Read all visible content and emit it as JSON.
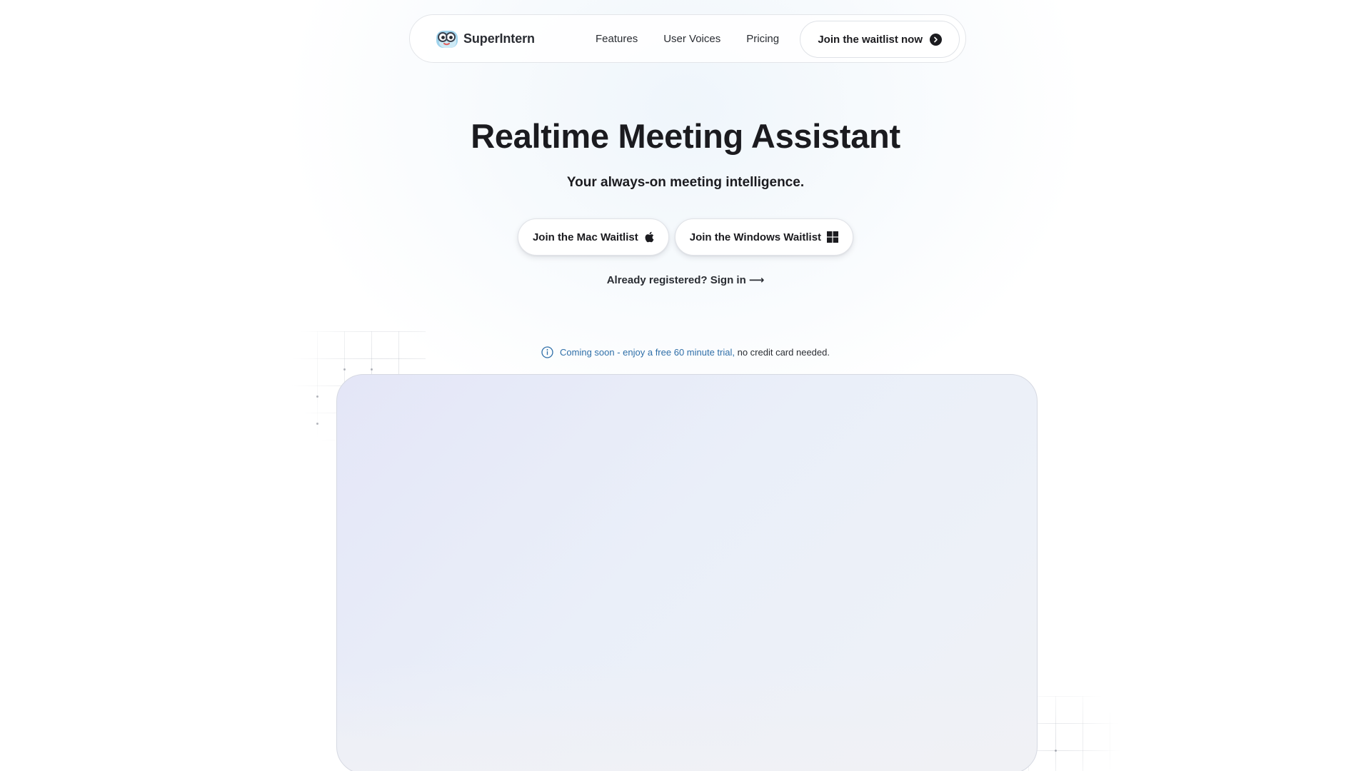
{
  "nav": {
    "brand": "SuperIntern",
    "links": [
      "Features",
      "User Voices",
      "Pricing"
    ],
    "cta_label": "Join the waitlist now"
  },
  "hero": {
    "title": "Realtime Meeting Assistant",
    "subtitle": "Your always-on meeting intelligence.",
    "mac_button": "Join the Mac Waitlist",
    "windows_button": "Join the Windows Waitlist",
    "signin_text": "Already registered? Sign in",
    "signin_arrow": "⟶"
  },
  "notice": {
    "accent_text": "Coming soon - enjoy a free 60 minute trial,",
    "rest_text": "no credit card needed."
  },
  "colors": {
    "accent_blue": "#2f6fa8",
    "text_dark": "#1b1b1f",
    "panel_tint": "#e4e6f7"
  },
  "icons": {
    "brand": "superintern-logo-icon",
    "nav_cta": "arrow-right-circle-icon",
    "mac": "apple-icon",
    "windows": "windows-icon",
    "notice": "info-icon"
  }
}
